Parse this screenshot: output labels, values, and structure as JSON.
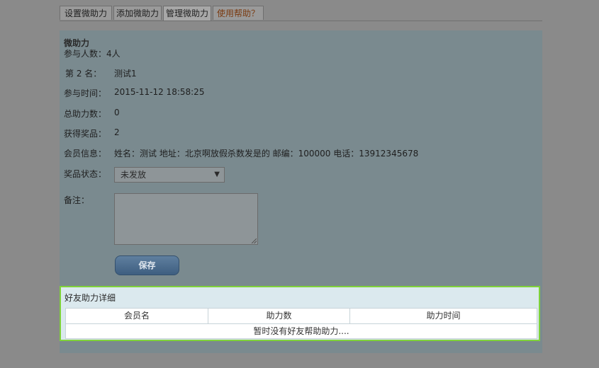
{
  "tabs": [
    {
      "label": "设置微助力"
    },
    {
      "label": "添加微助力"
    },
    {
      "label": "管理微助力"
    },
    {
      "label": "使用帮助？"
    }
  ],
  "detail": {
    "title": "微助力",
    "participants": "参与人数：4人",
    "rank_label": "第 2 名：",
    "rank_value": "测试1",
    "join_time_label": "参与时间：",
    "join_time_value": "2015-11-12 18:58:25",
    "total_help_label": "总助力数：",
    "total_help_value": "0",
    "prize_label": "获得奖品：",
    "prize_value": "2",
    "member_info_label": "会员信息：",
    "member_info_value": "姓名：测试 地址：北京啊放假杀数发是的 邮编：100000 电话：13912345678",
    "prize_status_label": "奖品状态：",
    "prize_status_value": "未发放",
    "remark_label": "备注：",
    "save_label": "保存"
  },
  "friends": {
    "title": "好友助力详细",
    "columns": [
      "会员名",
      "助力数",
      "助力时间"
    ],
    "empty_text": "暂时没有好友帮助助力...."
  }
}
